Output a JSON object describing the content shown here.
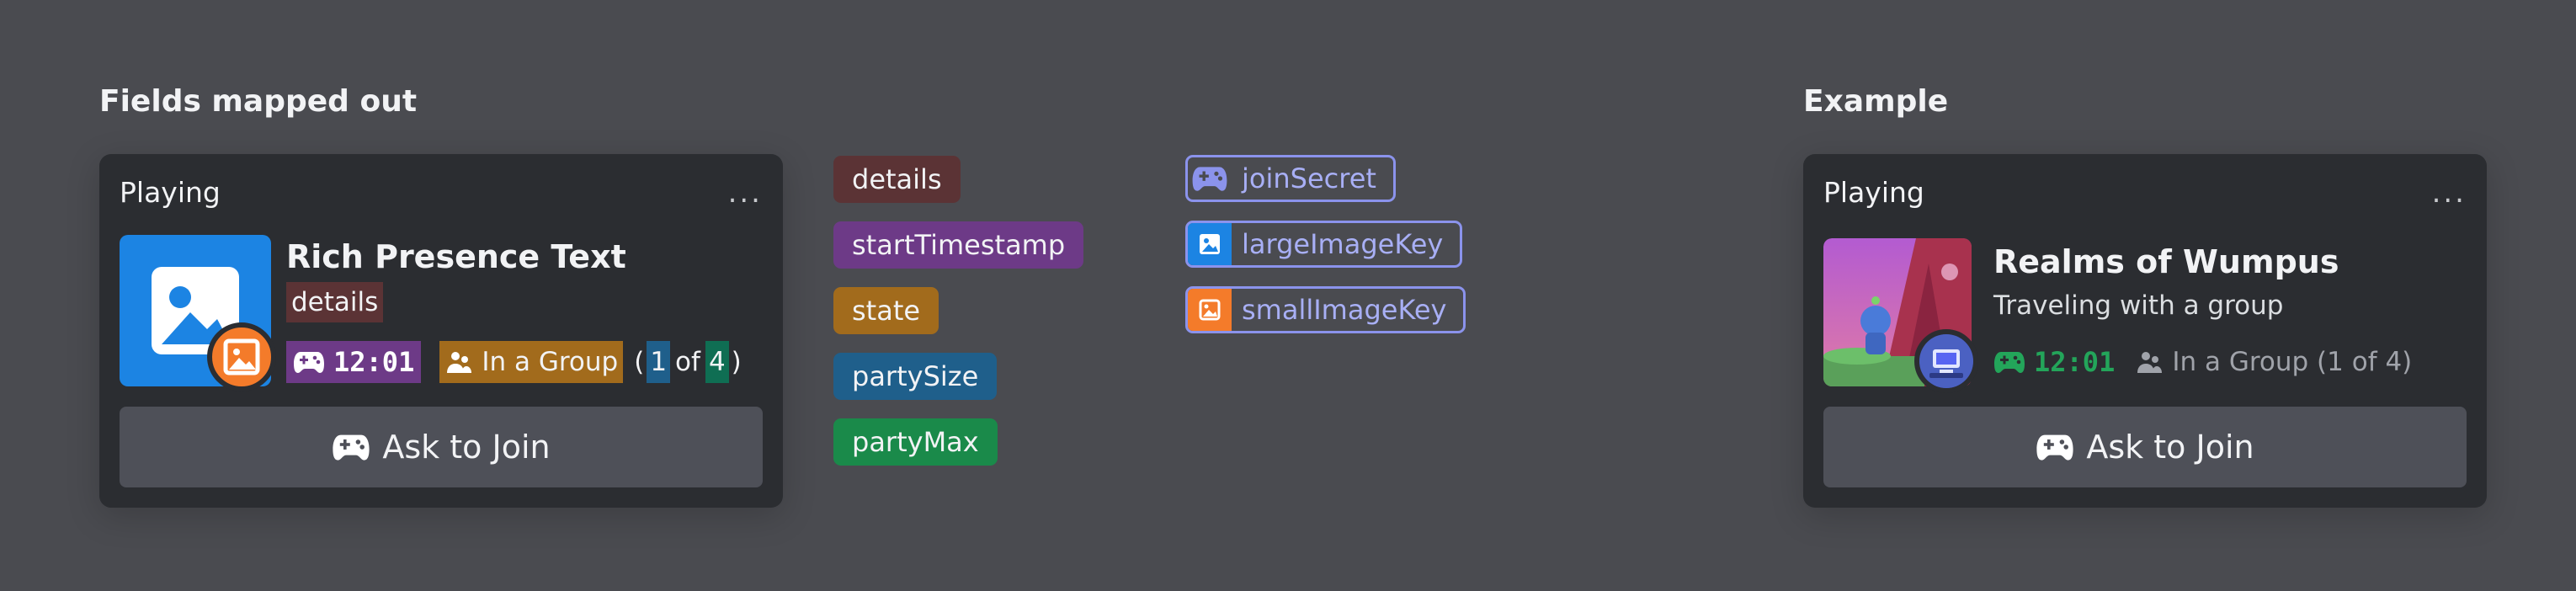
{
  "left": {
    "heading": "Fields mapped out",
    "card": {
      "label": "Playing",
      "more": "...",
      "name": "Rich Presence Text",
      "details": "details",
      "timestamp": "12:01",
      "state": "In a Group",
      "party_open": "(",
      "party_size": "1",
      "party_of": "of",
      "party_max": "4",
      "party_close": ")",
      "button": "Ask to Join"
    }
  },
  "legend": {
    "fields": [
      {
        "label": "details",
        "color": "#5b3335"
      },
      {
        "label": "startTimestamp",
        "color": "#6d3a87"
      },
      {
        "label": "state",
        "color": "#a26b1c"
      },
      {
        "label": "partySize",
        "color": "#1f5f8b"
      },
      {
        "label": "partyMax",
        "color": "#1a8a4a"
      }
    ],
    "keys": [
      {
        "label": "joinSecret",
        "icon": "gamepad-icon"
      },
      {
        "label": "largeImageKey",
        "icon": "image-icon"
      },
      {
        "label": "smallImageKey",
        "icon": "image-icon"
      }
    ]
  },
  "right": {
    "heading": "Example",
    "card": {
      "label": "Playing",
      "more": "...",
      "name": "Realms of Wumpus",
      "details": "Traveling with a group",
      "timestamp": "12:01",
      "state": "In a Group (1 of 4)",
      "button": "Ask to Join"
    }
  },
  "colors": {
    "background": "#4a4b50",
    "card": "#2b2d31",
    "button": "#4e5058",
    "large_image": "#1c84e3",
    "small_image": "#f47b2a",
    "key_border": "#8b93ec",
    "timestamp_green": "#23a55a"
  }
}
